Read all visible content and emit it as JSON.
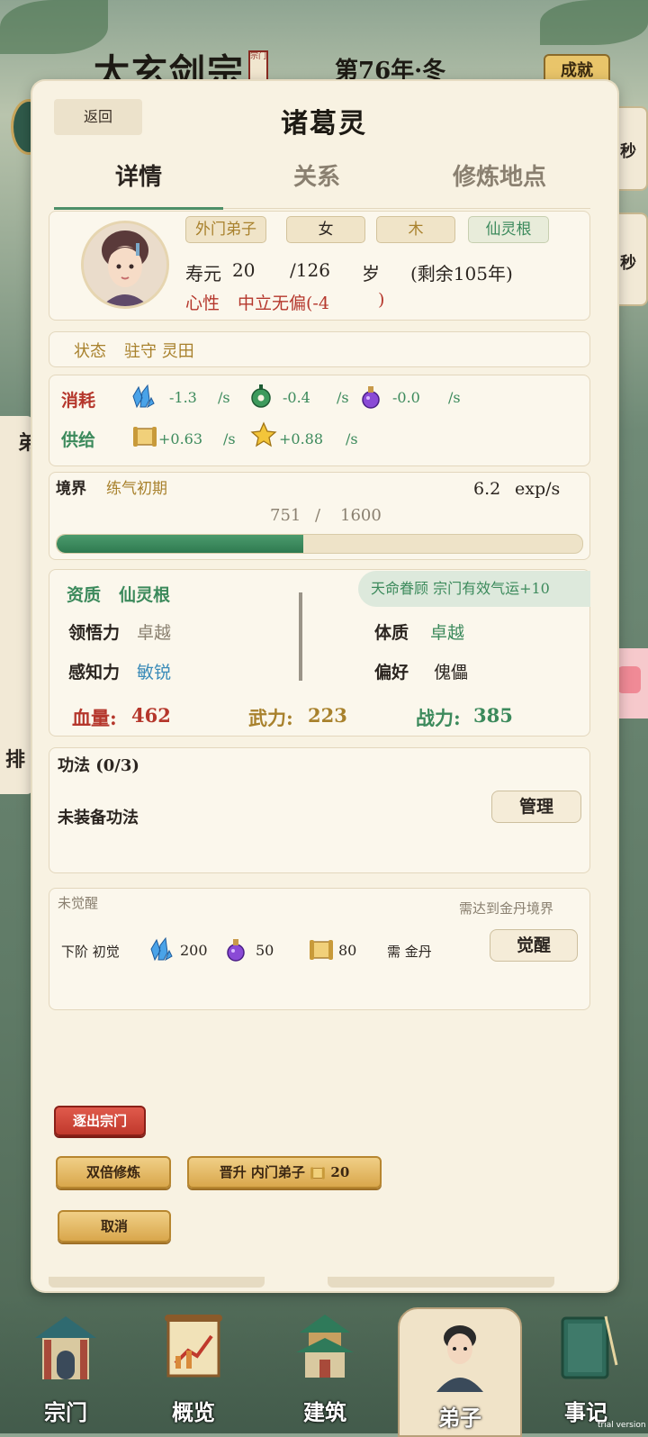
{
  "background": {
    "sect_name": "太玄剑宗",
    "seal_text": "宗门",
    "year": "第76年·冬",
    "achievements_button": "成就",
    "side_label_1": "秒",
    "side_label_2": "秒",
    "left_partial_1": "弟",
    "left_partial_2": "排"
  },
  "header": {
    "back_label": "返回",
    "title": "诸葛灵"
  },
  "tabs": [
    {
      "label": "详情",
      "active": true
    },
    {
      "label": "关系",
      "active": false
    },
    {
      "label": "修炼地点",
      "active": false
    }
  ],
  "profile": {
    "rank": "外门弟子",
    "gender": "女",
    "element": "木",
    "root": "仙灵根",
    "lifespan_label": "寿元",
    "age": "20",
    "max_age": "/126",
    "age_unit": "岁",
    "remaining": "(剩余105年)",
    "temperament_label": "心性",
    "temperament_value": "中立无偏(-4",
    "temperament_close": ")"
  },
  "status": {
    "label": "状态",
    "value": "驻守 灵田"
  },
  "economy": {
    "consume_label": "消耗",
    "consume": [
      {
        "icon": "spirit-crystal-icon",
        "value": "-1.3",
        "unit": "/s"
      },
      {
        "icon": "jade-icon",
        "value": "-0.4",
        "unit": "/s"
      },
      {
        "icon": "potion-icon",
        "value": "-0.0",
        "unit": "/s"
      }
    ],
    "supply_label": "供给",
    "supply": [
      {
        "icon": "scroll-icon",
        "value": "+0.63",
        "unit": "/s"
      },
      {
        "icon": "star-icon",
        "value": "+0.88",
        "unit": "/s"
      }
    ]
  },
  "realm": {
    "label": "境界",
    "value": "练气初期",
    "rate": "6.2",
    "rate_unit": "exp/s",
    "current": "751",
    "sep": "/",
    "total": "1600",
    "progress": 0.47
  },
  "aptitude": {
    "label": "资质",
    "value": "仙灵根",
    "fate_badge": "天命眷顾 宗门有效气运+10",
    "comprehension_label": "领悟力",
    "comprehension_value": "卓越",
    "perception_label": "感知力",
    "perception_value": "敏锐",
    "physique_label": "体质",
    "physique_value": "卓越",
    "preference_label": "偏好",
    "preference_value": "傀儡",
    "hp_label": "血量:",
    "hp_value": "462",
    "force_label": "武力:",
    "force_value": "223",
    "power_label": "战力:",
    "power_value": "385"
  },
  "techniques": {
    "title": "功法 (0/3)",
    "empty_text": "未装备功法",
    "manage_button": "管理"
  },
  "awakening": {
    "status": "未觉醒",
    "requirement": "需达到金丹境界",
    "next_label": "下阶 初觉",
    "costs": [
      {
        "icon": "spirit-crystal-icon",
        "value": "200"
      },
      {
        "icon": "potion-icon",
        "value": "50"
      },
      {
        "icon": "scroll-icon",
        "value": "80"
      }
    ],
    "need": "需 金丹",
    "awaken_button": "觉醒"
  },
  "actions": {
    "expel": "逐出宗门",
    "double_cultivate": "双倍修炼",
    "promote": "晋升 内门弟子",
    "promote_cost": "20",
    "cancel": "取消"
  },
  "nav": [
    {
      "label": "宗门",
      "icon": "sect-gate-icon"
    },
    {
      "label": "概览",
      "icon": "overview-scroll-icon"
    },
    {
      "label": "建筑",
      "icon": "pagoda-icon"
    },
    {
      "label": "弟子",
      "icon": "disciple-portrait-icon",
      "active": true
    },
    {
      "label": "事记",
      "icon": "record-book-icon"
    }
  ],
  "watermark": "trial version",
  "colors": {
    "accent_green": "#3c8a5c",
    "accent_red": "#b5372c",
    "accent_gold": "#a8812c",
    "panel": "#f8f2e2"
  }
}
